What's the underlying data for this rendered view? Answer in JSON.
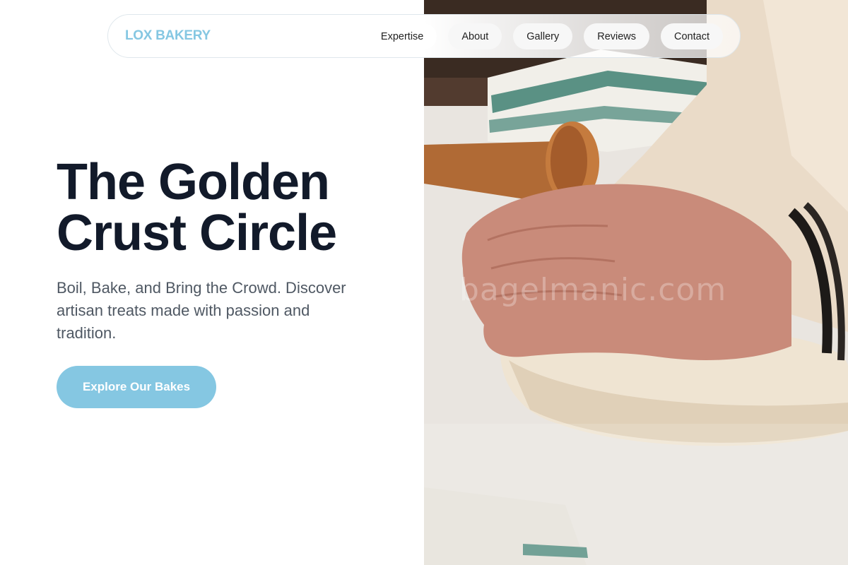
{
  "brand": {
    "name": "LOX BAKERY",
    "color": "#85c7e2"
  },
  "nav": {
    "items": [
      {
        "label": "Expertise"
      },
      {
        "label": "About"
      },
      {
        "label": "Gallery"
      },
      {
        "label": "Reviews"
      },
      {
        "label": "Contact"
      }
    ]
  },
  "hero": {
    "title_line1": "The Golden",
    "title_line2": "Crust Circle",
    "subtitle": "Boil, Bake, and Bring the Crowd. Discover artisan treats made with passion and tradition.",
    "cta_label": "Explore Our Bakes",
    "image_watermark": "bagelmanic.com"
  },
  "colors": {
    "accent": "#85c7e2",
    "title": "#121a2a",
    "body_text": "#4f5863"
  }
}
